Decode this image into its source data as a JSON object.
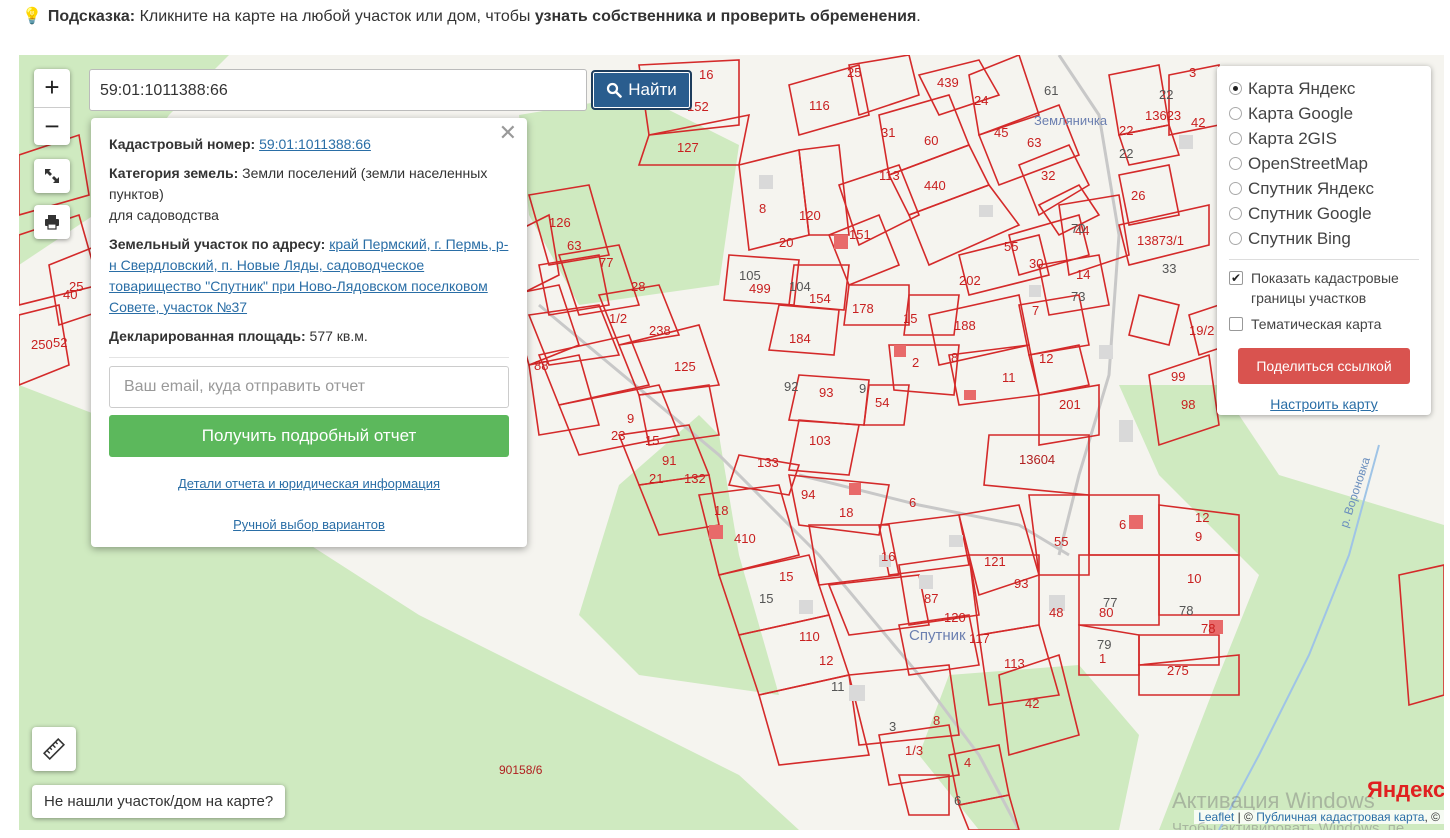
{
  "hint": {
    "icon": "lightbulb-icon",
    "label": "Подсказка:",
    "text": " Кликните на карте на любой участок или дом, чтобы ",
    "bold": "узнать собственника и проверить обременения",
    "end": "."
  },
  "search": {
    "value": "59:01:1011388:66",
    "button": "Найти"
  },
  "zoom": {
    "in": "+",
    "out": "−"
  },
  "popup": {
    "cadastral_label": "Кадастровый номер:",
    "cadastral_value": "59:01:1011388:66",
    "category_label": "Категория земель:",
    "category_value": "Земли поселений (земли населенных пунктов)",
    "category_use": "для садоводства",
    "address_label": "Земельный участок по адресу:",
    "address_value": "край Пермский, г. Пермь, р-н Свердловский, п. Новые Ляды, садоводческое товарищество \"Спутник\" при Ново-Лядовском поселковом Совете, участок №37",
    "area_label": "Декларированная площадь:",
    "area_value": "577 кв.м.",
    "email_placeholder": "Ваш email, куда отправить отчет",
    "report_button": "Получить подробный отчет",
    "details_link": "Детали отчета и юридическая информация",
    "manual_link": "Ручной выбор вариантов",
    "close": "✕"
  },
  "layers": {
    "options": [
      {
        "label": "Карта Яндекс",
        "selected": true
      },
      {
        "label": "Карта Google",
        "selected": false
      },
      {
        "label": "Карта 2GIS",
        "selected": false
      },
      {
        "label": "OpenStreetMap",
        "selected": false
      },
      {
        "label": "Спутник Яндекс",
        "selected": false
      },
      {
        "label": "Спутник Google",
        "selected": false
      },
      {
        "label": "Спутник Bing",
        "selected": false
      }
    ],
    "show_borders": "Показать кадастровые границы участков",
    "show_borders_checked": true,
    "thematic": "Тематическая карта",
    "thematic_checked": false,
    "share": "Поделиться ссылкой",
    "settings": "Настроить карту"
  },
  "bottom": {
    "not_found": "Не нашли участок/дом на карте?",
    "yandex_logo": "Яндекс",
    "win_activation": "Активация Windows",
    "win_activation_sub": "Чтобы активировать Windows, пе",
    "attrib_leaflet": "Leaflet",
    "attrib_sep": " | © ",
    "attrib_pkk": "Публичная кадастровая карта",
    "attrib_end": ", ©"
  },
  "map_labels": {
    "sputnik": "Спутник",
    "river": "р. Вороновка",
    "plot_90158": "90158/6",
    "plot_13604": "13604",
    "zemlyanichka": "Земляничка"
  },
  "colors": {
    "search_button": "#2a5d8e",
    "report_button": "#5cb85c",
    "share_button": "#d9534f",
    "parcel_border": "#d42a2a",
    "green_area": "#cfeac0"
  }
}
